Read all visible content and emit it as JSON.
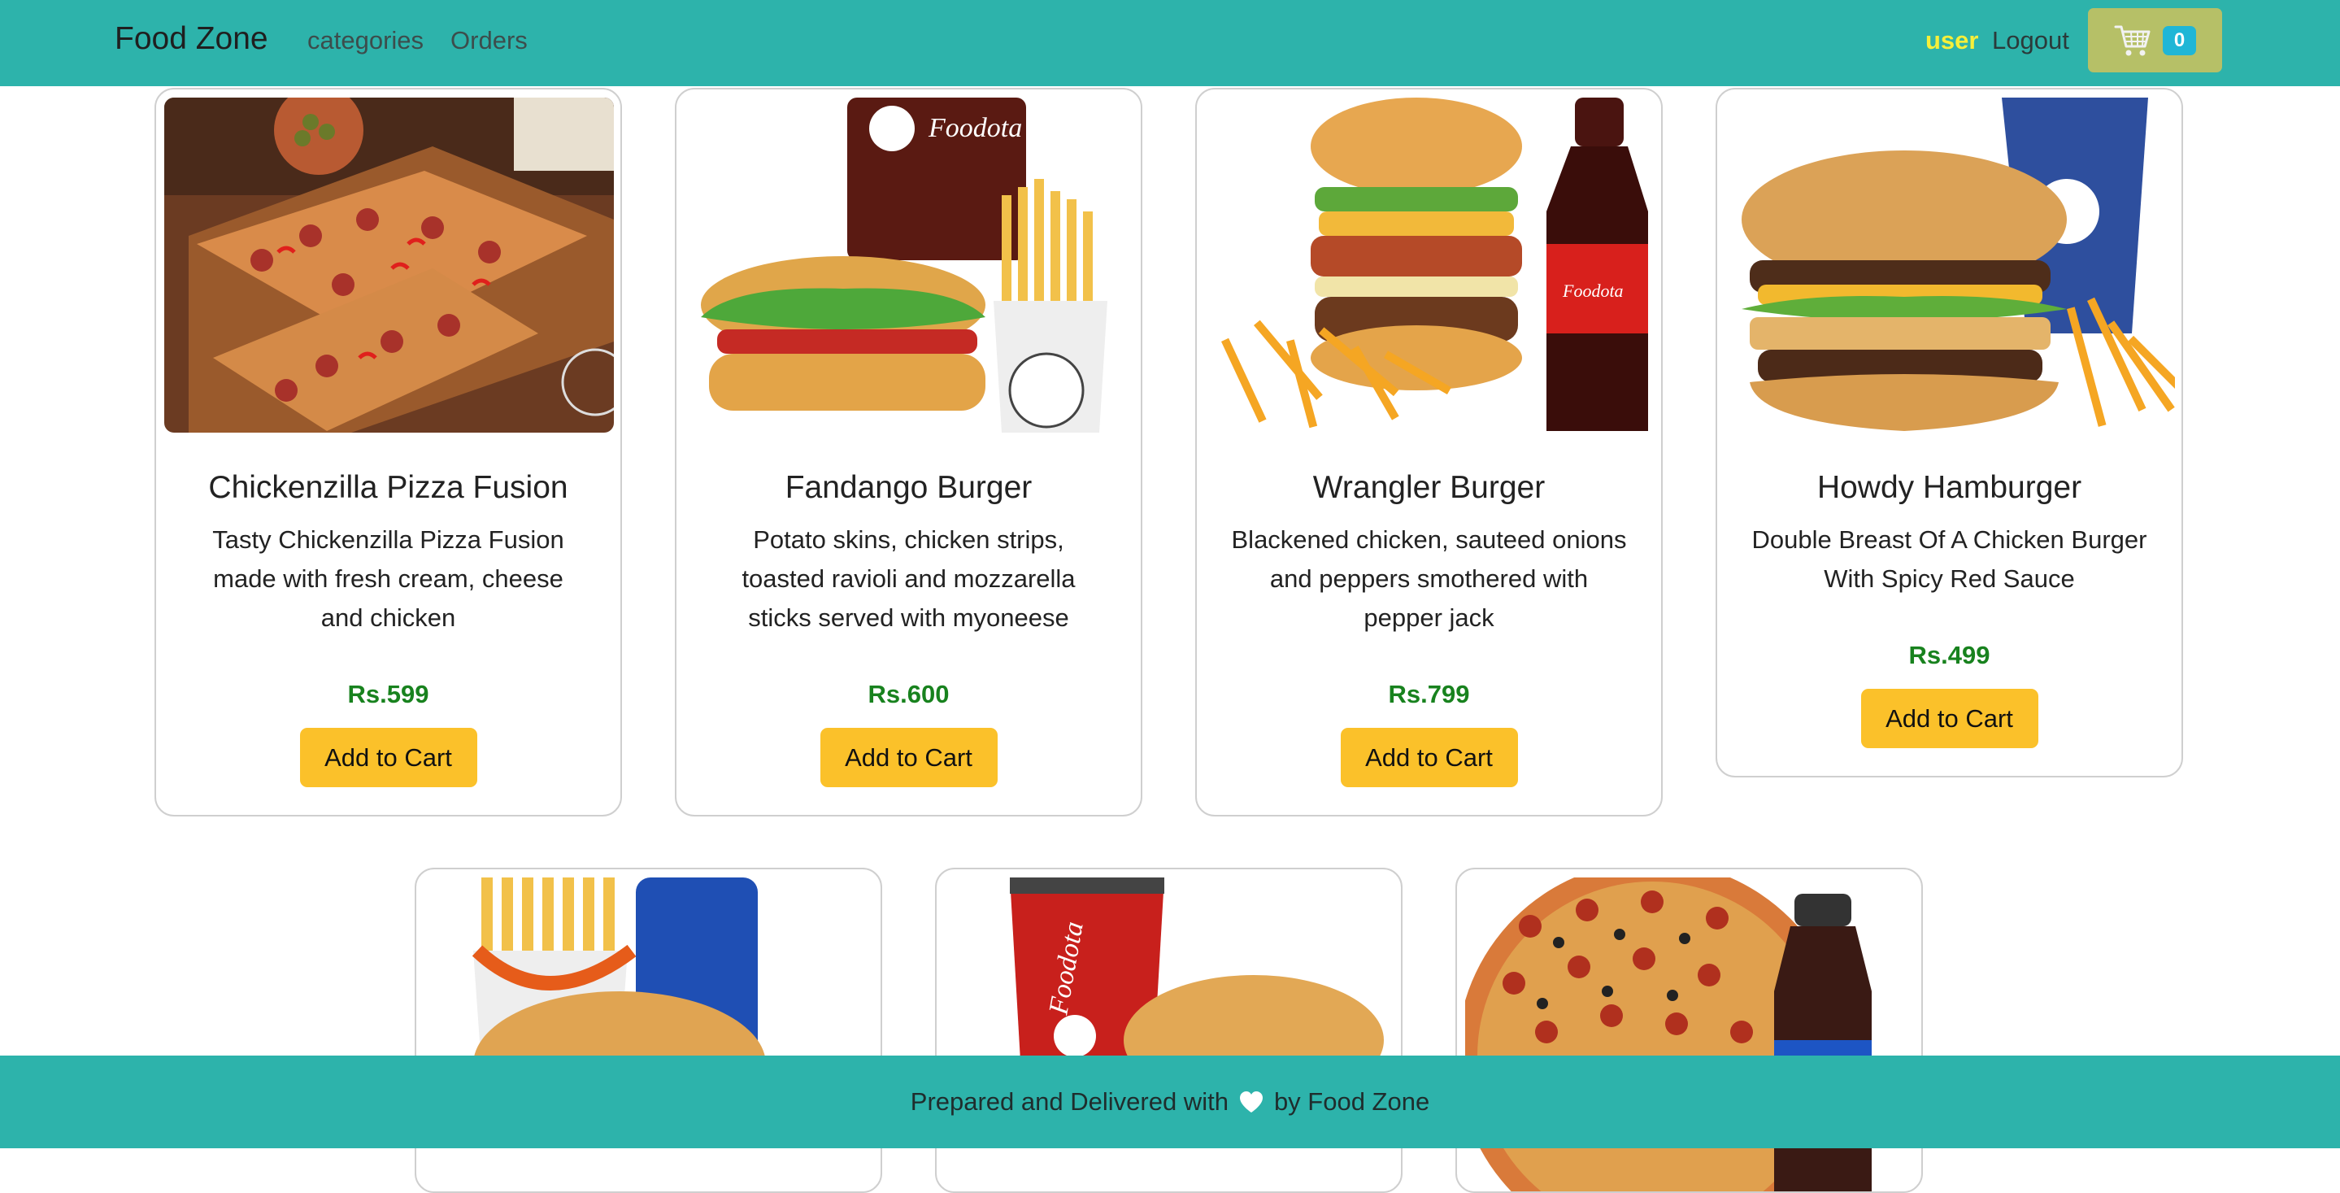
{
  "navbar": {
    "brand": "Food Zone",
    "links": [
      "categories",
      "Orders"
    ],
    "user": "user",
    "logout": "Logout",
    "cart_count": "0",
    "cart_icon": "cart-icon"
  },
  "products": [
    {
      "name": "Chickenzilla Pizza Fusion",
      "description": "Tasty Chickenzilla Pizza Fusion made with fresh cream, cheese and chicken",
      "price": "Rs.599",
      "button": "Add to Cart"
    },
    {
      "name": "Fandango Burger",
      "description": "Potato skins, chicken strips, toasted ravioli and mozzarella sticks served with myoneese",
      "price": "Rs.600",
      "button": "Add to Cart"
    },
    {
      "name": "Wrangler Burger",
      "description": "Blackened chicken, sauteed onions and peppers smothered with pepper jack",
      "price": "Rs.799",
      "button": "Add to Cart"
    },
    {
      "name": "Howdy Hamburger",
      "description": "Double Breast Of A Chicken Burger With Spicy Red Sauce",
      "price": "Rs.499",
      "button": "Add to Cart"
    }
  ],
  "footer": {
    "text_before": "Prepared and Delivered with",
    "text_after": "by Food Zone",
    "icon": "heart-icon"
  },
  "colors": {
    "navbar": "#2db3ab",
    "price": "#18821e",
    "button": "#fbc12a",
    "user": "#f6ef3a",
    "cart_button": "#b6c067",
    "cart_badge": "#1fb6d6"
  }
}
